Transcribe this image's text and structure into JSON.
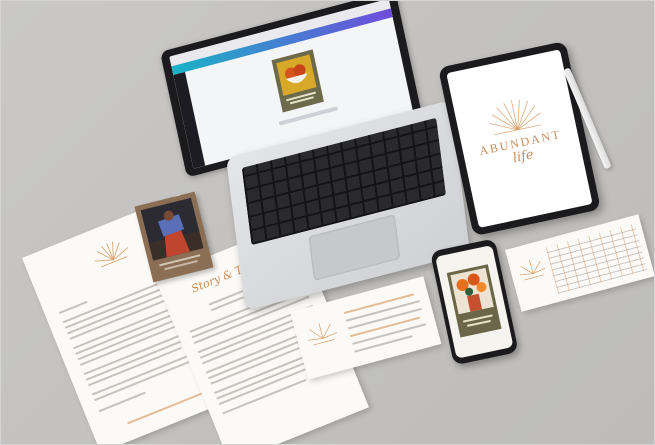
{
  "tablet": {
    "brand_line1": "ABUNDANT",
    "brand_line2": "life"
  },
  "letter": {
    "heading": "Story & Testimony"
  },
  "colors": {
    "backdrop": "#c5c4c2",
    "paper": "#fbfaf7",
    "accent_orange": "#d9a06a",
    "laptop_silver": "#d7d8da",
    "device_black": "#1b1b1d"
  }
}
